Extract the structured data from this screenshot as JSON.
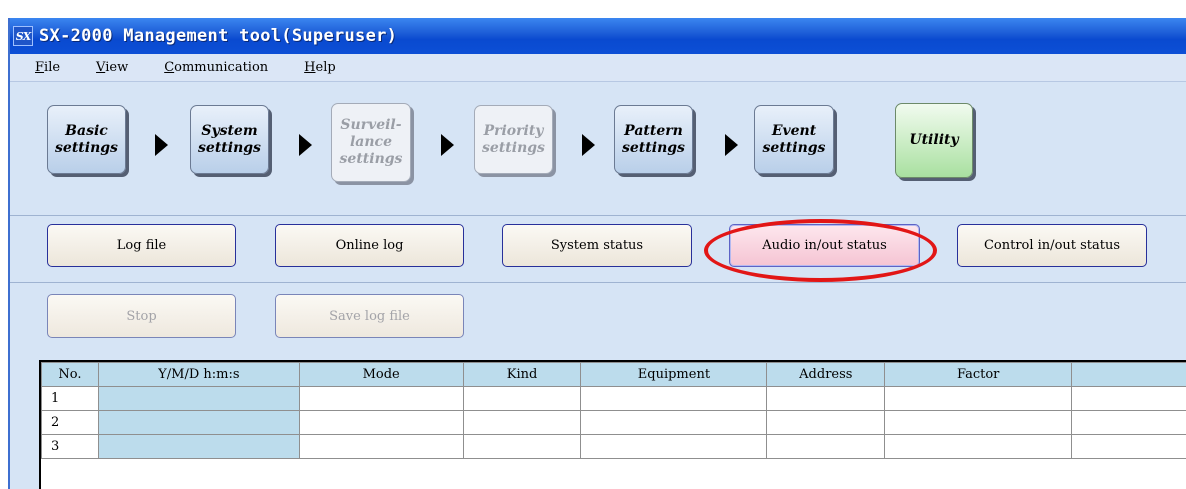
{
  "window": {
    "title": "SX-2000 Management tool(Superuser)",
    "icon": "SX"
  },
  "menu": [
    {
      "label": "File",
      "accel": "F",
      "rest": "ile"
    },
    {
      "label": "View",
      "accel": "V",
      "rest": "iew"
    },
    {
      "label": "Communication",
      "accel": "C",
      "rest": "ommunication"
    },
    {
      "label": "Help",
      "accel": "H",
      "rest": "elp"
    }
  ],
  "steps": [
    {
      "label": "Basic\nsettings",
      "state": "active"
    },
    {
      "label": "System\nsettings",
      "state": "active"
    },
    {
      "label": "Surveil-\nlance\nsettings",
      "state": "disabled"
    },
    {
      "label": "Priority\nsettings",
      "state": "disabled"
    },
    {
      "label": "Pattern\nsettings",
      "state": "active"
    },
    {
      "label": "Event\nsettings",
      "state": "active"
    },
    {
      "label": "Utility",
      "state": "selected"
    }
  ],
  "functions": [
    {
      "label": "Log file"
    },
    {
      "label": "Online log"
    },
    {
      "label": "System status"
    },
    {
      "label": "Audio in/out status",
      "selected": true
    },
    {
      "label": "Control in/out status"
    }
  ],
  "actions": [
    {
      "label": "Stop",
      "enabled": false
    },
    {
      "label": "Save log file",
      "enabled": false
    }
  ],
  "table": {
    "columns": [
      "No.",
      "Y/M/D h:m:s",
      "Mode",
      "Kind",
      "Equipment",
      "Address",
      "Factor",
      ""
    ],
    "rows": [
      "1",
      "2",
      "3"
    ]
  },
  "colors": {
    "title_bar": "#0a4ad0",
    "highlight_ring": "#e21616",
    "header_fill": "#bcdcec",
    "utility_fill": "#a9e0a0",
    "selected_button": "#f5c4d3"
  }
}
